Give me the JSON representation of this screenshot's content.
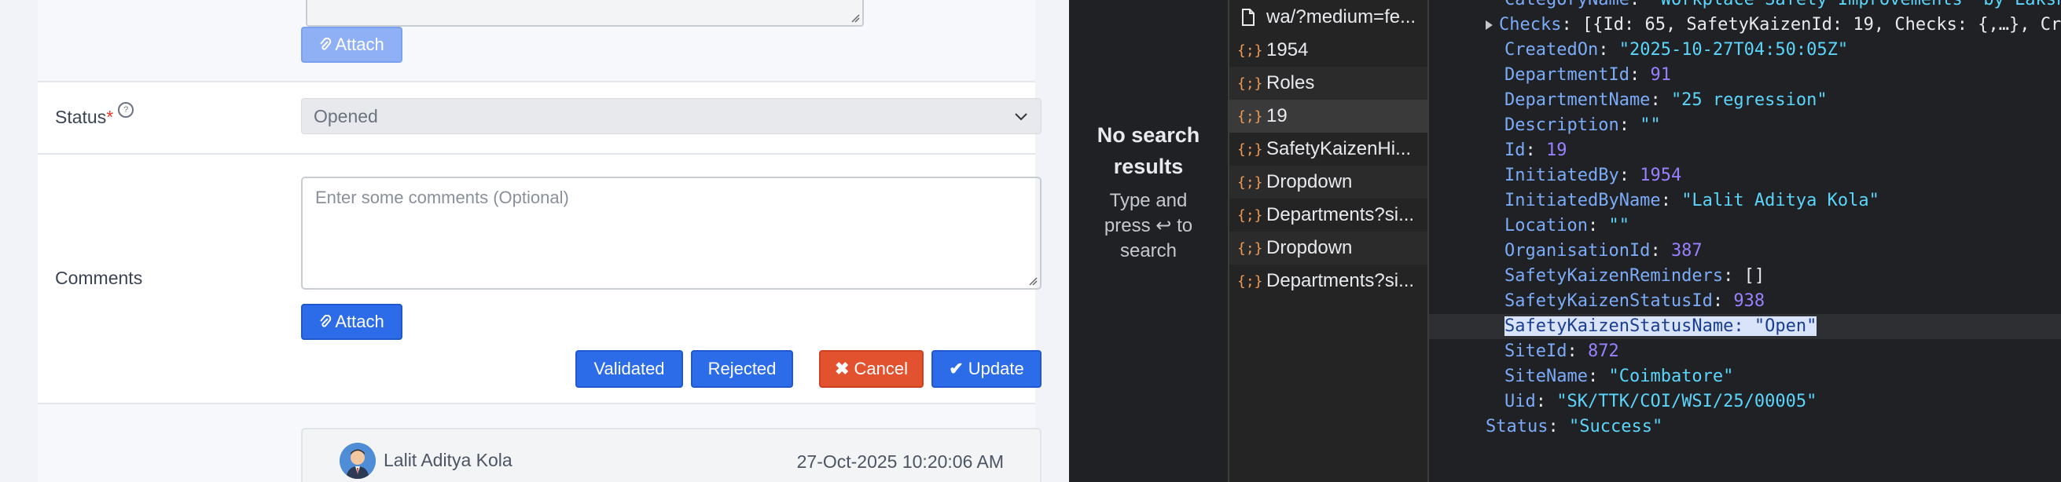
{
  "form": {
    "attach_label": "Attach",
    "status": {
      "label": "Status",
      "required_mark": "*",
      "info_icon": "?",
      "selected": "Opened"
    },
    "comments": {
      "label": "Comments",
      "placeholder": "Enter some comments (Optional)"
    },
    "actions": {
      "validated": "Validated",
      "rejected": "Rejected",
      "cancel": "Cancel",
      "update": "Update"
    },
    "comment_entry": {
      "author": "Lalit Aditya Kola",
      "timestamp": "27-Oct-2025 10:20:06 AM"
    },
    "colors": {
      "primary": "#2d6ce8",
      "danger": "#e2522f"
    }
  },
  "devtools": {
    "search": {
      "title_line1": "No search",
      "title_line2": "results",
      "hint_line1": "Type and",
      "hint_line2": "press",
      "hint_line3": "to",
      "hint_line4": "search",
      "enter_icon": "↩"
    },
    "requests": [
      {
        "name": "wa/?medium=fe...",
        "icon": "document-icon"
      },
      {
        "name": "1954",
        "icon": "json-icon"
      },
      {
        "name": "Roles",
        "icon": "json-icon"
      },
      {
        "name": "19",
        "icon": "json-icon"
      },
      {
        "name": "SafetyKaizenHi...",
        "icon": "json-icon"
      },
      {
        "name": "Dropdown",
        "icon": "json-icon"
      },
      {
        "name": "Departments?si...",
        "icon": "json-icon"
      },
      {
        "name": "Dropdown",
        "icon": "json-icon"
      },
      {
        "name": "Departments?si...",
        "icon": "json-icon"
      }
    ],
    "json_icon_glyph": "{;}",
    "preview": {
      "line0": {
        "key": "CategoryName",
        "value": "\"Workplace Safety Improvements  by Laksh"
      },
      "checks": {
        "key": "Checks",
        "value": "[{Id: 65, SafetyKaizenId: 19, Checks: {,…}, Cr"
      },
      "fields": [
        {
          "key": "CreatedOn",
          "value": "\"2025-10-27T04:50:05Z\"",
          "type": "s"
        },
        {
          "key": "DepartmentId",
          "value": "91",
          "type": "n"
        },
        {
          "key": "DepartmentName",
          "value": "\"25 regression\"",
          "type": "s"
        },
        {
          "key": "Description",
          "value": "\"\"",
          "type": "s"
        },
        {
          "key": "Id",
          "value": "19",
          "type": "n"
        },
        {
          "key": "InitiatedBy",
          "value": "1954",
          "type": "n"
        },
        {
          "key": "InitiatedByName",
          "value": "\"Lalit Aditya Kola\"",
          "type": "s"
        },
        {
          "key": "Location",
          "value": "\"\"",
          "type": "s"
        },
        {
          "key": "OrganisationId",
          "value": "387",
          "type": "n"
        },
        {
          "key": "SafetyKaizenReminders",
          "value": "[]",
          "type": "p"
        },
        {
          "key": "SafetyKaizenStatusId",
          "value": "938",
          "type": "n"
        },
        {
          "key": "SafetyKaizenStatusName",
          "value": "\"Open\"",
          "type": "hl"
        },
        {
          "key": "SiteId",
          "value": "872",
          "type": "n"
        },
        {
          "key": "SiteName",
          "value": "\"Coimbatore\"",
          "type": "s"
        },
        {
          "key": "Uid",
          "value": "\"SK/TTK/COI/WSI/25/00005\"",
          "type": "s"
        }
      ],
      "status": {
        "key": "Status",
        "value": "\"Success\""
      }
    }
  }
}
